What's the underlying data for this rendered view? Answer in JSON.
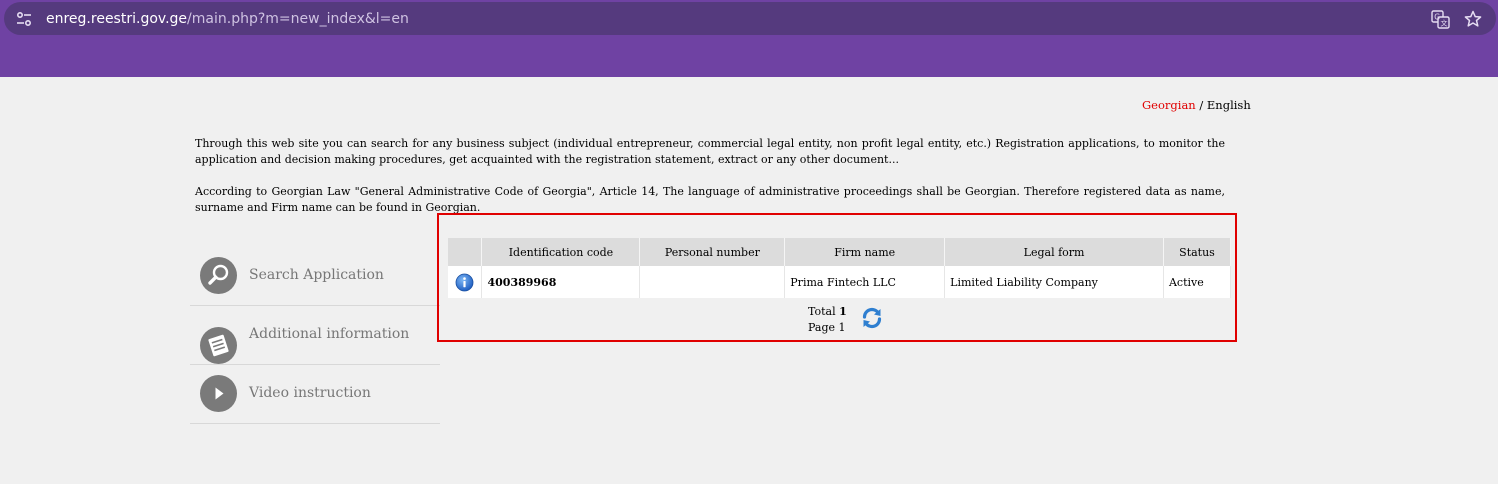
{
  "browser": {
    "url_host": "enreg.reestri.gov.ge",
    "url_path": "/main.php?m=new_index&l=en",
    "icons": [
      "site-info-icon",
      "translate-icon",
      "star-icon"
    ]
  },
  "language": {
    "georgian": "Georgian",
    "separator": " / ",
    "english": "English"
  },
  "intro": {
    "paragraph1": "Through this web site you can search for any business subject (individual entrepreneur, commercial legal entity, non profit legal entity, etc.) Registration applications, to monitor the application and decision making procedures, get acquainted with the registration statement, extract or any other document...",
    "paragraph2": "According to Georgian Law \"General Administrative Code of Georgia\", Article 14, The language of administrative proceedings shall be Georgian. Therefore registered data as name, surname and Firm name can be found in Georgian."
  },
  "menu": {
    "items": [
      {
        "label": "Search Application",
        "icon": "magnifier-icon"
      },
      {
        "label": "Additional information",
        "icon": "document-icon"
      },
      {
        "label": "Video instruction",
        "icon": "play-icon"
      }
    ]
  },
  "results": {
    "columns": [
      "",
      "Identification code",
      "Personal number",
      "Firm name",
      "Legal form",
      "Status"
    ],
    "rows": [
      {
        "identification_code": "400389968",
        "personal_number": "",
        "firm_name": "Prima Fintech LLC",
        "legal_form": "Limited Liability Company",
        "status": "Active"
      }
    ],
    "total_label": "Total",
    "total_value": "1",
    "page_label": "Page",
    "page_value": "1"
  },
  "colors": {
    "chrome": "#6f42a3",
    "omnibox": "#553a7e",
    "highlight": "#e00000",
    "status_active": "#1a8a1a",
    "georgian_link": "#e00000"
  }
}
